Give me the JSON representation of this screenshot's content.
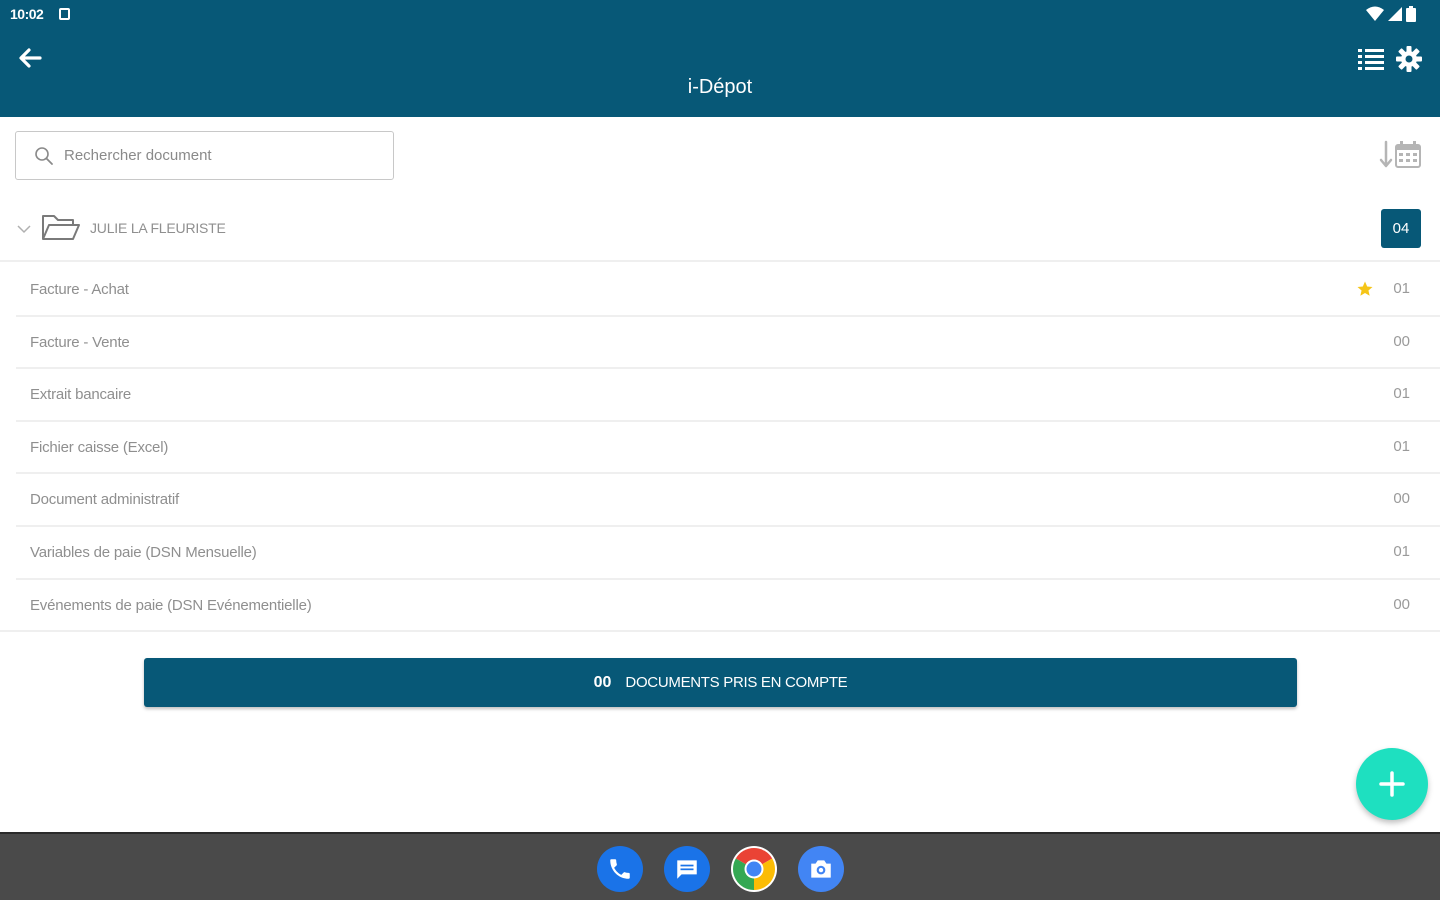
{
  "status_bar": {
    "time": "10:02"
  },
  "toolbar": {
    "title": "i-Dépot"
  },
  "search": {
    "placeholder": "Rechercher document"
  },
  "folder": {
    "name": "JULIE LA FLEURISTE",
    "count": "04"
  },
  "categories": [
    {
      "label": "Facture - Achat",
      "count": "01",
      "starred": true
    },
    {
      "label": "Facture - Vente",
      "count": "00"
    },
    {
      "label": "Extrait bancaire",
      "count": "01"
    },
    {
      "label": "Fichier caisse (Excel)",
      "count": "01"
    },
    {
      "label": "Document administratif",
      "count": "00"
    },
    {
      "label": "Variables de paie (DSN Mensuelle)",
      "count": "01"
    },
    {
      "label": "Evénements de paie (DSN Evénementielle)",
      "count": "00"
    }
  ],
  "documents_button": {
    "count": "00",
    "label": "DOCUMENTS PRIS EN COMPTE"
  },
  "colors": {
    "primary": "#075877",
    "accent": "#1ee0c0",
    "star": "#f5c518",
    "dock": "#4a4a4a"
  },
  "dock_apps": [
    "phone-icon",
    "messages-icon",
    "chrome-icon",
    "camera-icon"
  ]
}
